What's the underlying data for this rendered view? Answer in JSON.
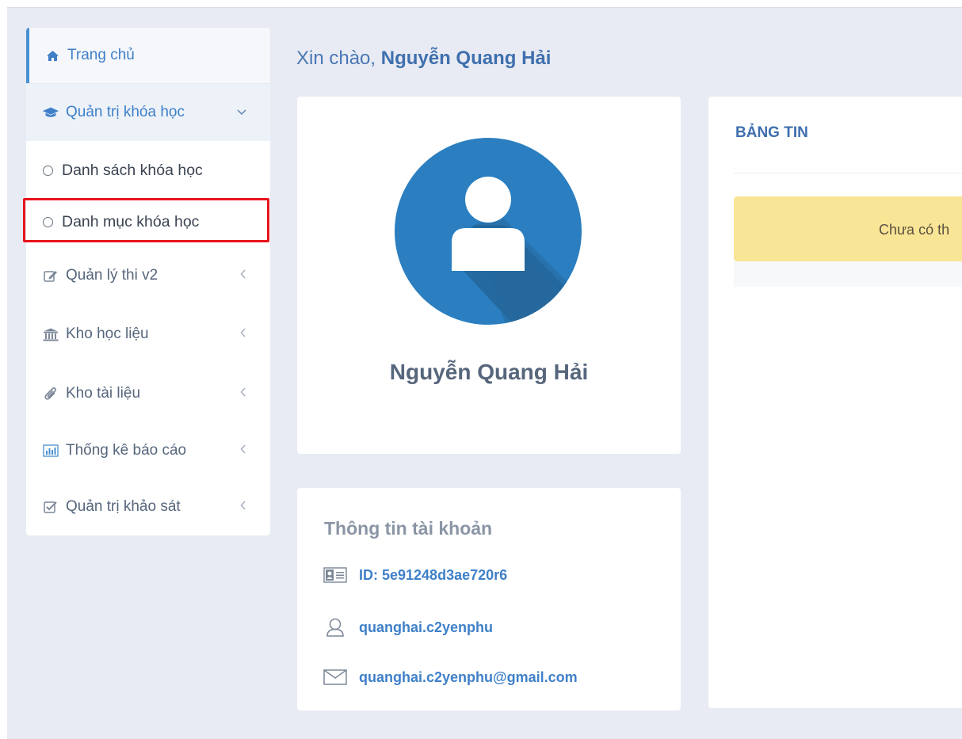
{
  "sidebar": {
    "items": [
      {
        "label": "Trang chủ",
        "icon": "home-icon"
      },
      {
        "label": "Quản trị khóa học",
        "icon": "graduation-cap-icon"
      },
      {
        "label": "Danh sách khóa học",
        "icon": "circle-icon"
      },
      {
        "label": "Danh mục khóa học",
        "icon": "circle-icon"
      },
      {
        "label": "Quản lý thi v2",
        "icon": "edit-icon"
      },
      {
        "label": "Kho học liệu",
        "icon": "institution-icon"
      },
      {
        "label": "Kho tài liệu",
        "icon": "paperclip-icon"
      },
      {
        "label": "Thống kê báo cáo",
        "icon": "bar-chart-icon"
      },
      {
        "label": "Quản trị khảo sát",
        "icon": "check-square-icon"
      }
    ]
  },
  "greeting": {
    "prefix": "Xin chào, ",
    "name": "Nguyễn Quang Hải"
  },
  "profile": {
    "name": "Nguyễn Quang Hải"
  },
  "account": {
    "title": "Thông tin tài khoản",
    "id": "ID: 5e91248d3ae720r6",
    "username": "quanghai.c2yenphu",
    "email": "quanghai.c2yenphu@gmail.com"
  },
  "news": {
    "title": "BẢNG TIN",
    "empty_text": "Chưa có th"
  },
  "colors": {
    "accent": "#3f80c8",
    "highlight": "#e8141c",
    "avatar_bg": "#2b7fc0",
    "alert_bg": "#f9e596",
    "page_bg": "#e8ebf3"
  }
}
